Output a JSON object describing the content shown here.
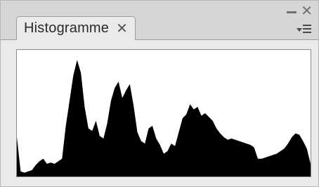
{
  "panel": {
    "tab_label": "Histogramme",
    "tab_close_icon": "close-icon",
    "minimize_icon": "minimize-icon",
    "close_icon": "close-icon",
    "menu_icon": "panel-menu-icon"
  },
  "histogram": {
    "fill_color": "#000000",
    "background_color": "#ffffff",
    "levels": [
      0.31,
      0.04,
      0.03,
      0.04,
      0.05,
      0.09,
      0.12,
      0.14,
      0.1,
      0.11,
      0.1,
      0.12,
      0.14,
      0.4,
      0.6,
      0.8,
      0.92,
      0.82,
      0.55,
      0.38,
      0.36,
      0.44,
      0.32,
      0.3,
      0.42,
      0.6,
      0.7,
      0.75,
      0.62,
      0.68,
      0.73,
      0.56,
      0.35,
      0.28,
      0.26,
      0.38,
      0.4,
      0.3,
      0.25,
      0.18,
      0.2,
      0.26,
      0.24,
      0.35,
      0.46,
      0.49,
      0.57,
      0.53,
      0.55,
      0.48,
      0.5,
      0.47,
      0.44,
      0.38,
      0.34,
      0.31,
      0.29,
      0.3,
      0.29,
      0.28,
      0.27,
      0.26,
      0.25,
      0.23,
      0.14,
      0.14,
      0.15,
      0.16,
      0.17,
      0.18,
      0.2,
      0.22,
      0.26,
      0.31,
      0.34,
      0.33,
      0.28,
      0.22,
      0.1
    ]
  }
}
